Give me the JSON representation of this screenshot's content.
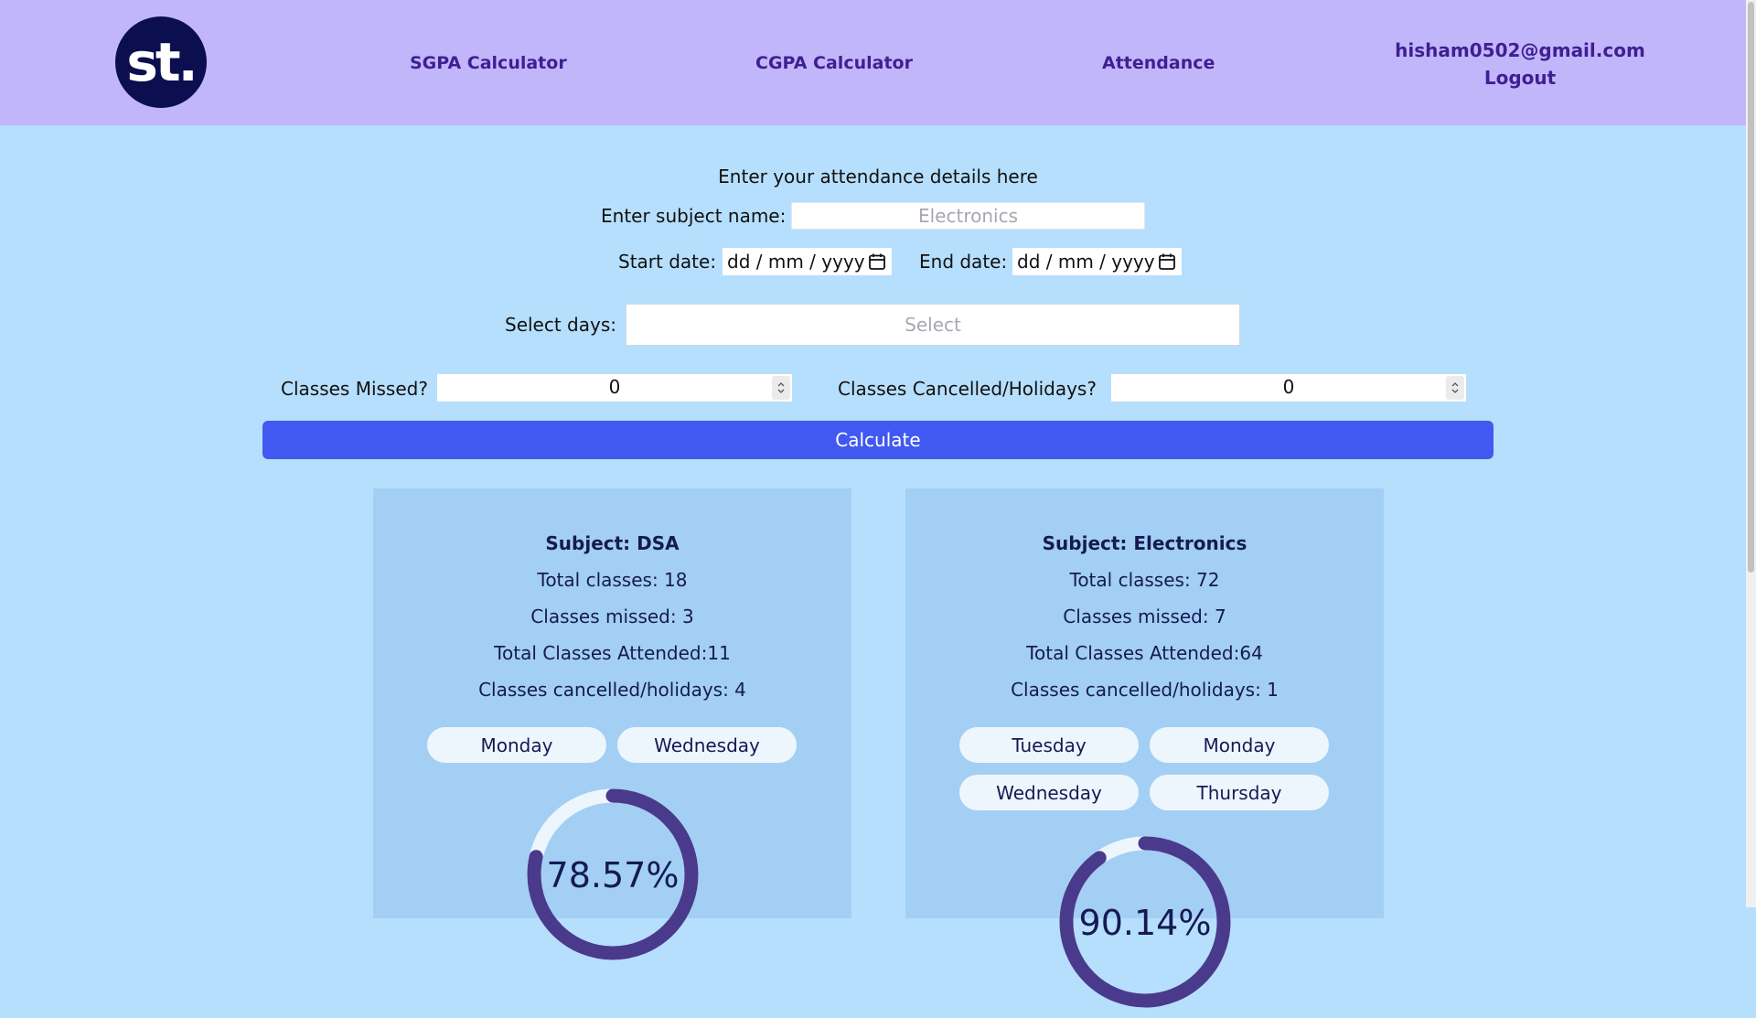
{
  "header": {
    "logo_text": "st.",
    "nav": [
      "SGPA Calculator",
      "CGPA Calculator",
      "Attendance"
    ],
    "user_email": "hisham0502@gmail.com",
    "logout": "Logout"
  },
  "form": {
    "heading": "Enter your attendance details here",
    "subject_label": "Enter subject name:",
    "subject_placeholder": "Electronics",
    "start_label": "Start date:",
    "start_value": "dd / mm / yyyy",
    "end_label": "End date:",
    "end_value": "dd / mm / yyyy",
    "days_label": "Select days:",
    "days_placeholder": "Select",
    "missed_label": "Classes Missed?",
    "missed_value": "0",
    "cancelled_label": "Classes Cancelled/Holidays?",
    "cancelled_value": "0",
    "calculate": "Calculate"
  },
  "cards": [
    {
      "subject": "Subject: DSA",
      "total": "Total classes: 18",
      "missed": "Classes missed: 3",
      "attended": "Total Classes Attended:11",
      "cancelled": "Classes cancelled/holidays: 4",
      "days": [
        "Monday",
        "Wednesday"
      ],
      "percent_text": "78.57%",
      "percent": 78.57
    },
    {
      "subject": "Subject: Electronics",
      "total": "Total classes: 72",
      "missed": "Classes missed: 7",
      "attended": "Total Classes Attended:64",
      "cancelled": "Classes cancelled/holidays: 1",
      "days": [
        "Tuesday",
        "Monday",
        "Wednesday",
        "Thursday"
      ],
      "percent_text": "90.14%",
      "percent": 90.14
    }
  ],
  "colors": {
    "header_bg": "#c2b6fb",
    "page_bg": "#b6dffd",
    "card_bg": "#a3cff4",
    "button": "#4159f0",
    "gauge": "#4a3a8c",
    "gauge_track": "#eef6fd"
  }
}
